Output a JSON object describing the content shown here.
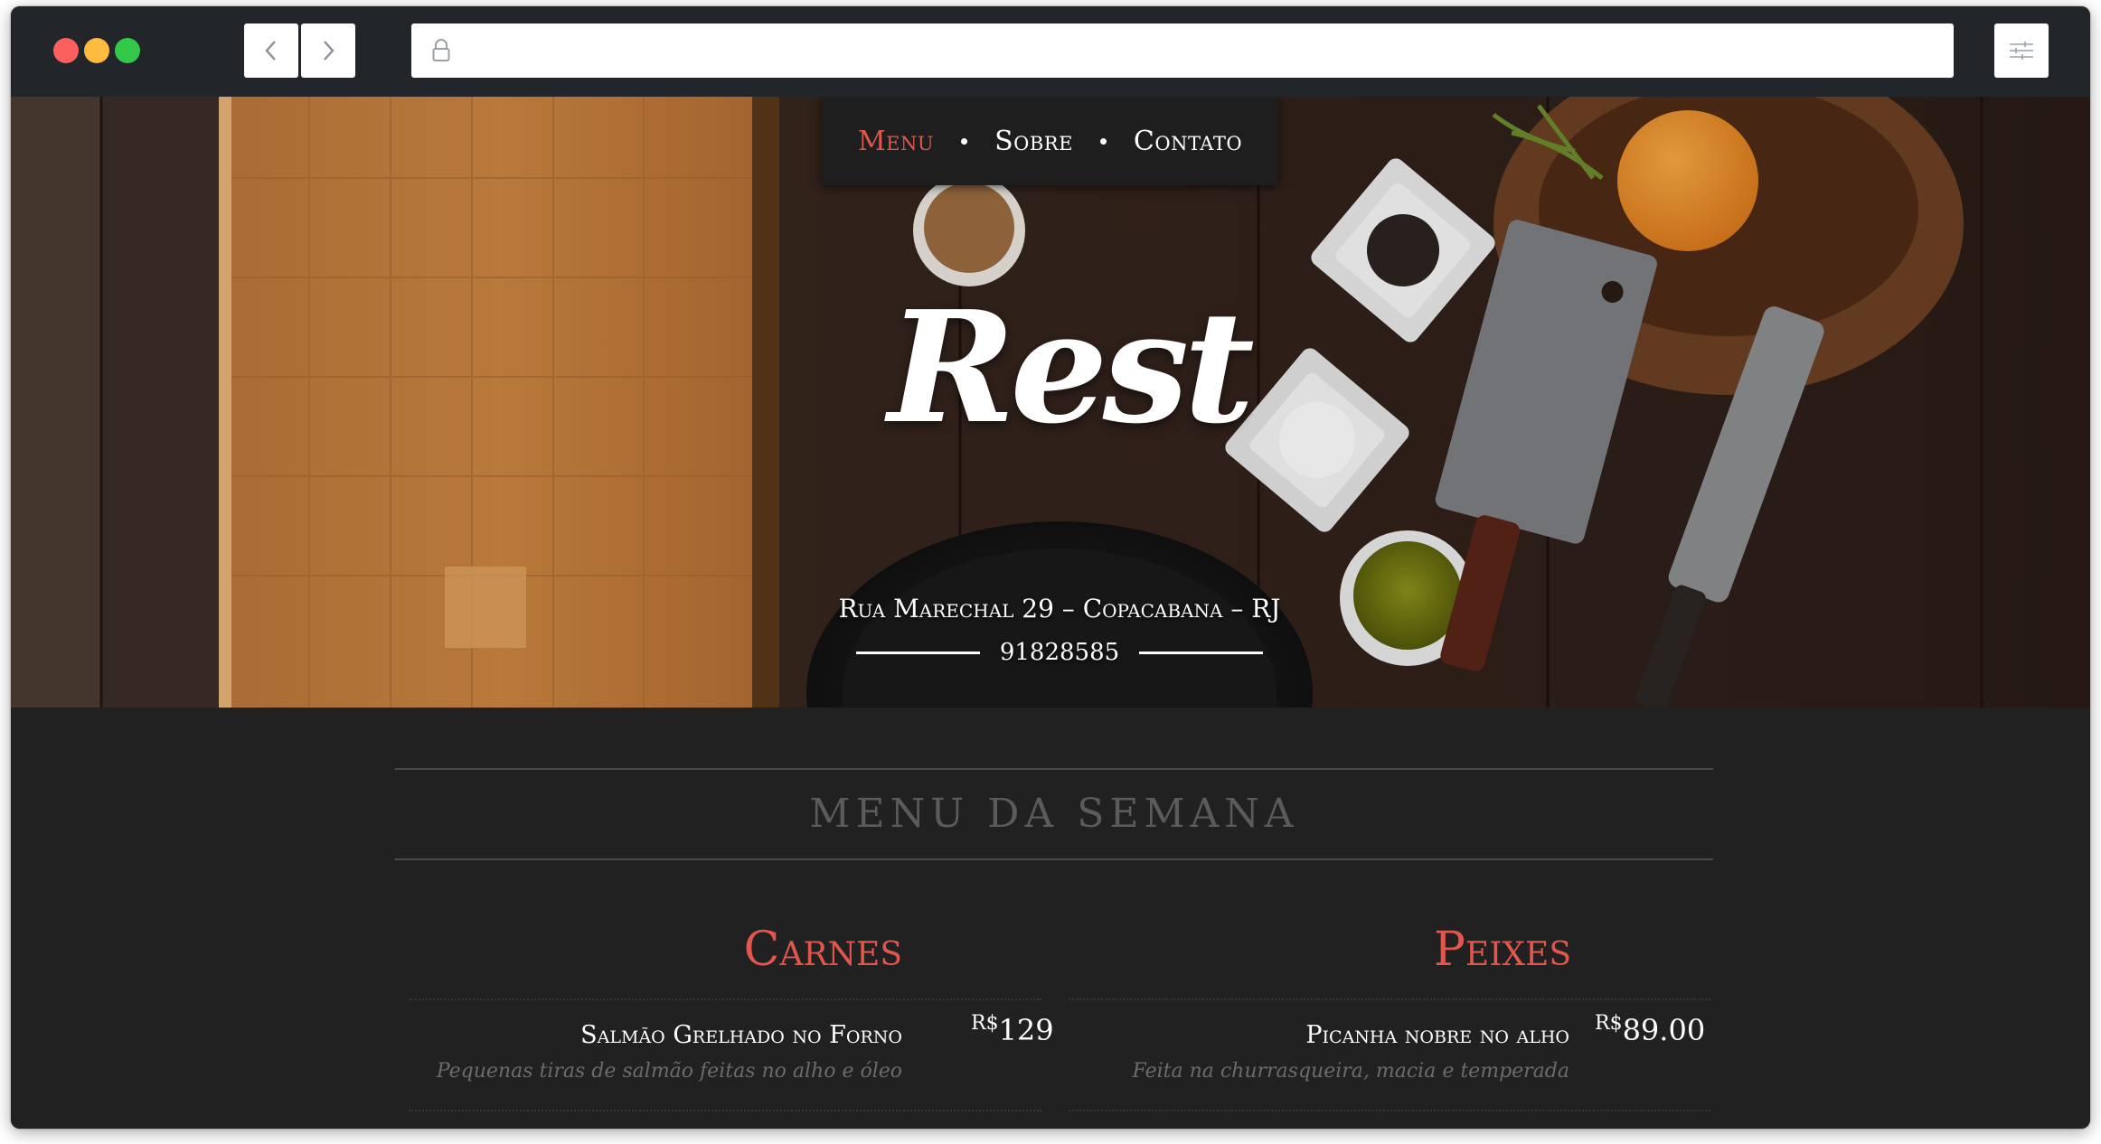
{
  "browser": {
    "url": "",
    "icons": {
      "back": "chevron-left-icon",
      "forward": "chevron-right-icon",
      "lock": "lock-icon",
      "menu": "sliders-icon"
    }
  },
  "nav": {
    "items": [
      {
        "label": "Menu",
        "active": true
      },
      {
        "label": "Sobre",
        "active": false
      },
      {
        "label": "Contato",
        "active": false
      }
    ]
  },
  "hero": {
    "logo": "Rest",
    "address": "Rua Marechal 29 – Copacabana – RJ",
    "phone": "91828585"
  },
  "menu": {
    "title": "MENU DA SEMANA",
    "categories": [
      {
        "title": "Carnes",
        "items": [
          {
            "name": "Salmão Grelhado no Forno",
            "desc": "Pequenas tiras de salmão feitas no alho e óleo",
            "currency": "R$",
            "price": "129"
          }
        ]
      },
      {
        "title": "Peixes",
        "items": [
          {
            "name": "Picanha nobre no alho",
            "desc": "Feita na churrasqueira, macia e temperada",
            "currency": "R$",
            "price": "89.00"
          }
        ]
      }
    ]
  },
  "colors": {
    "accent": "#e2574c",
    "page_bg": "#212121",
    "chrome_bg": "#22262b"
  }
}
